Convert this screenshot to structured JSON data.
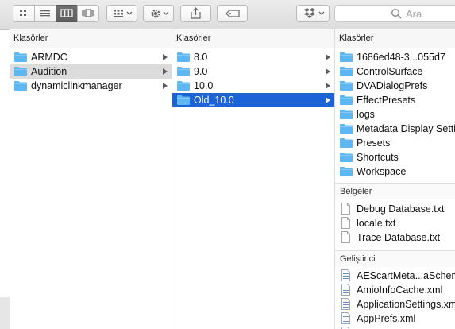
{
  "toolbar": {
    "view_icons": [
      "icon-view-icon",
      "list-view-icon",
      "column-view-icon",
      "coverflow-view-icon"
    ],
    "search_placeholder": "Ara"
  },
  "col1": {
    "header": "Klasörler",
    "items": [
      {
        "label": "ARMDC"
      },
      {
        "label": "Audition"
      },
      {
        "label": "dynamiclinkmanager"
      }
    ]
  },
  "col2": {
    "header": "Klasörler",
    "items": [
      {
        "label": "8.0"
      },
      {
        "label": "9.0"
      },
      {
        "label": "10.0"
      },
      {
        "label": "Old_10.0"
      }
    ]
  },
  "col3": {
    "header": "Klasörler",
    "folders": [
      {
        "label": "1686ed48-3...055d7"
      },
      {
        "label": "ControlSurface"
      },
      {
        "label": "DVADialogPrefs"
      },
      {
        "label": "EffectPresets"
      },
      {
        "label": "logs"
      },
      {
        "label": "Metadata Display Setti"
      },
      {
        "label": "Presets"
      },
      {
        "label": "Shortcuts"
      },
      {
        "label": "Workspace"
      }
    ],
    "docs_header": "Belgeler",
    "docs": [
      {
        "label": "Debug Database.txt"
      },
      {
        "label": "locale.txt"
      },
      {
        "label": "Trace Database.txt"
      }
    ],
    "dev_header": "Geliştirici",
    "dev": [
      {
        "label": "AEScartMeta...aSchem"
      },
      {
        "label": "AmioInfoCache.xml"
      },
      {
        "label": "ApplicationSettings.xm"
      },
      {
        "label": "AppPrefs.xml"
      }
    ]
  },
  "colors": {
    "selection_blue": "#1b63d6",
    "selection_gray": "#dcdcdc",
    "folder_blue": "#5eb6f2"
  }
}
